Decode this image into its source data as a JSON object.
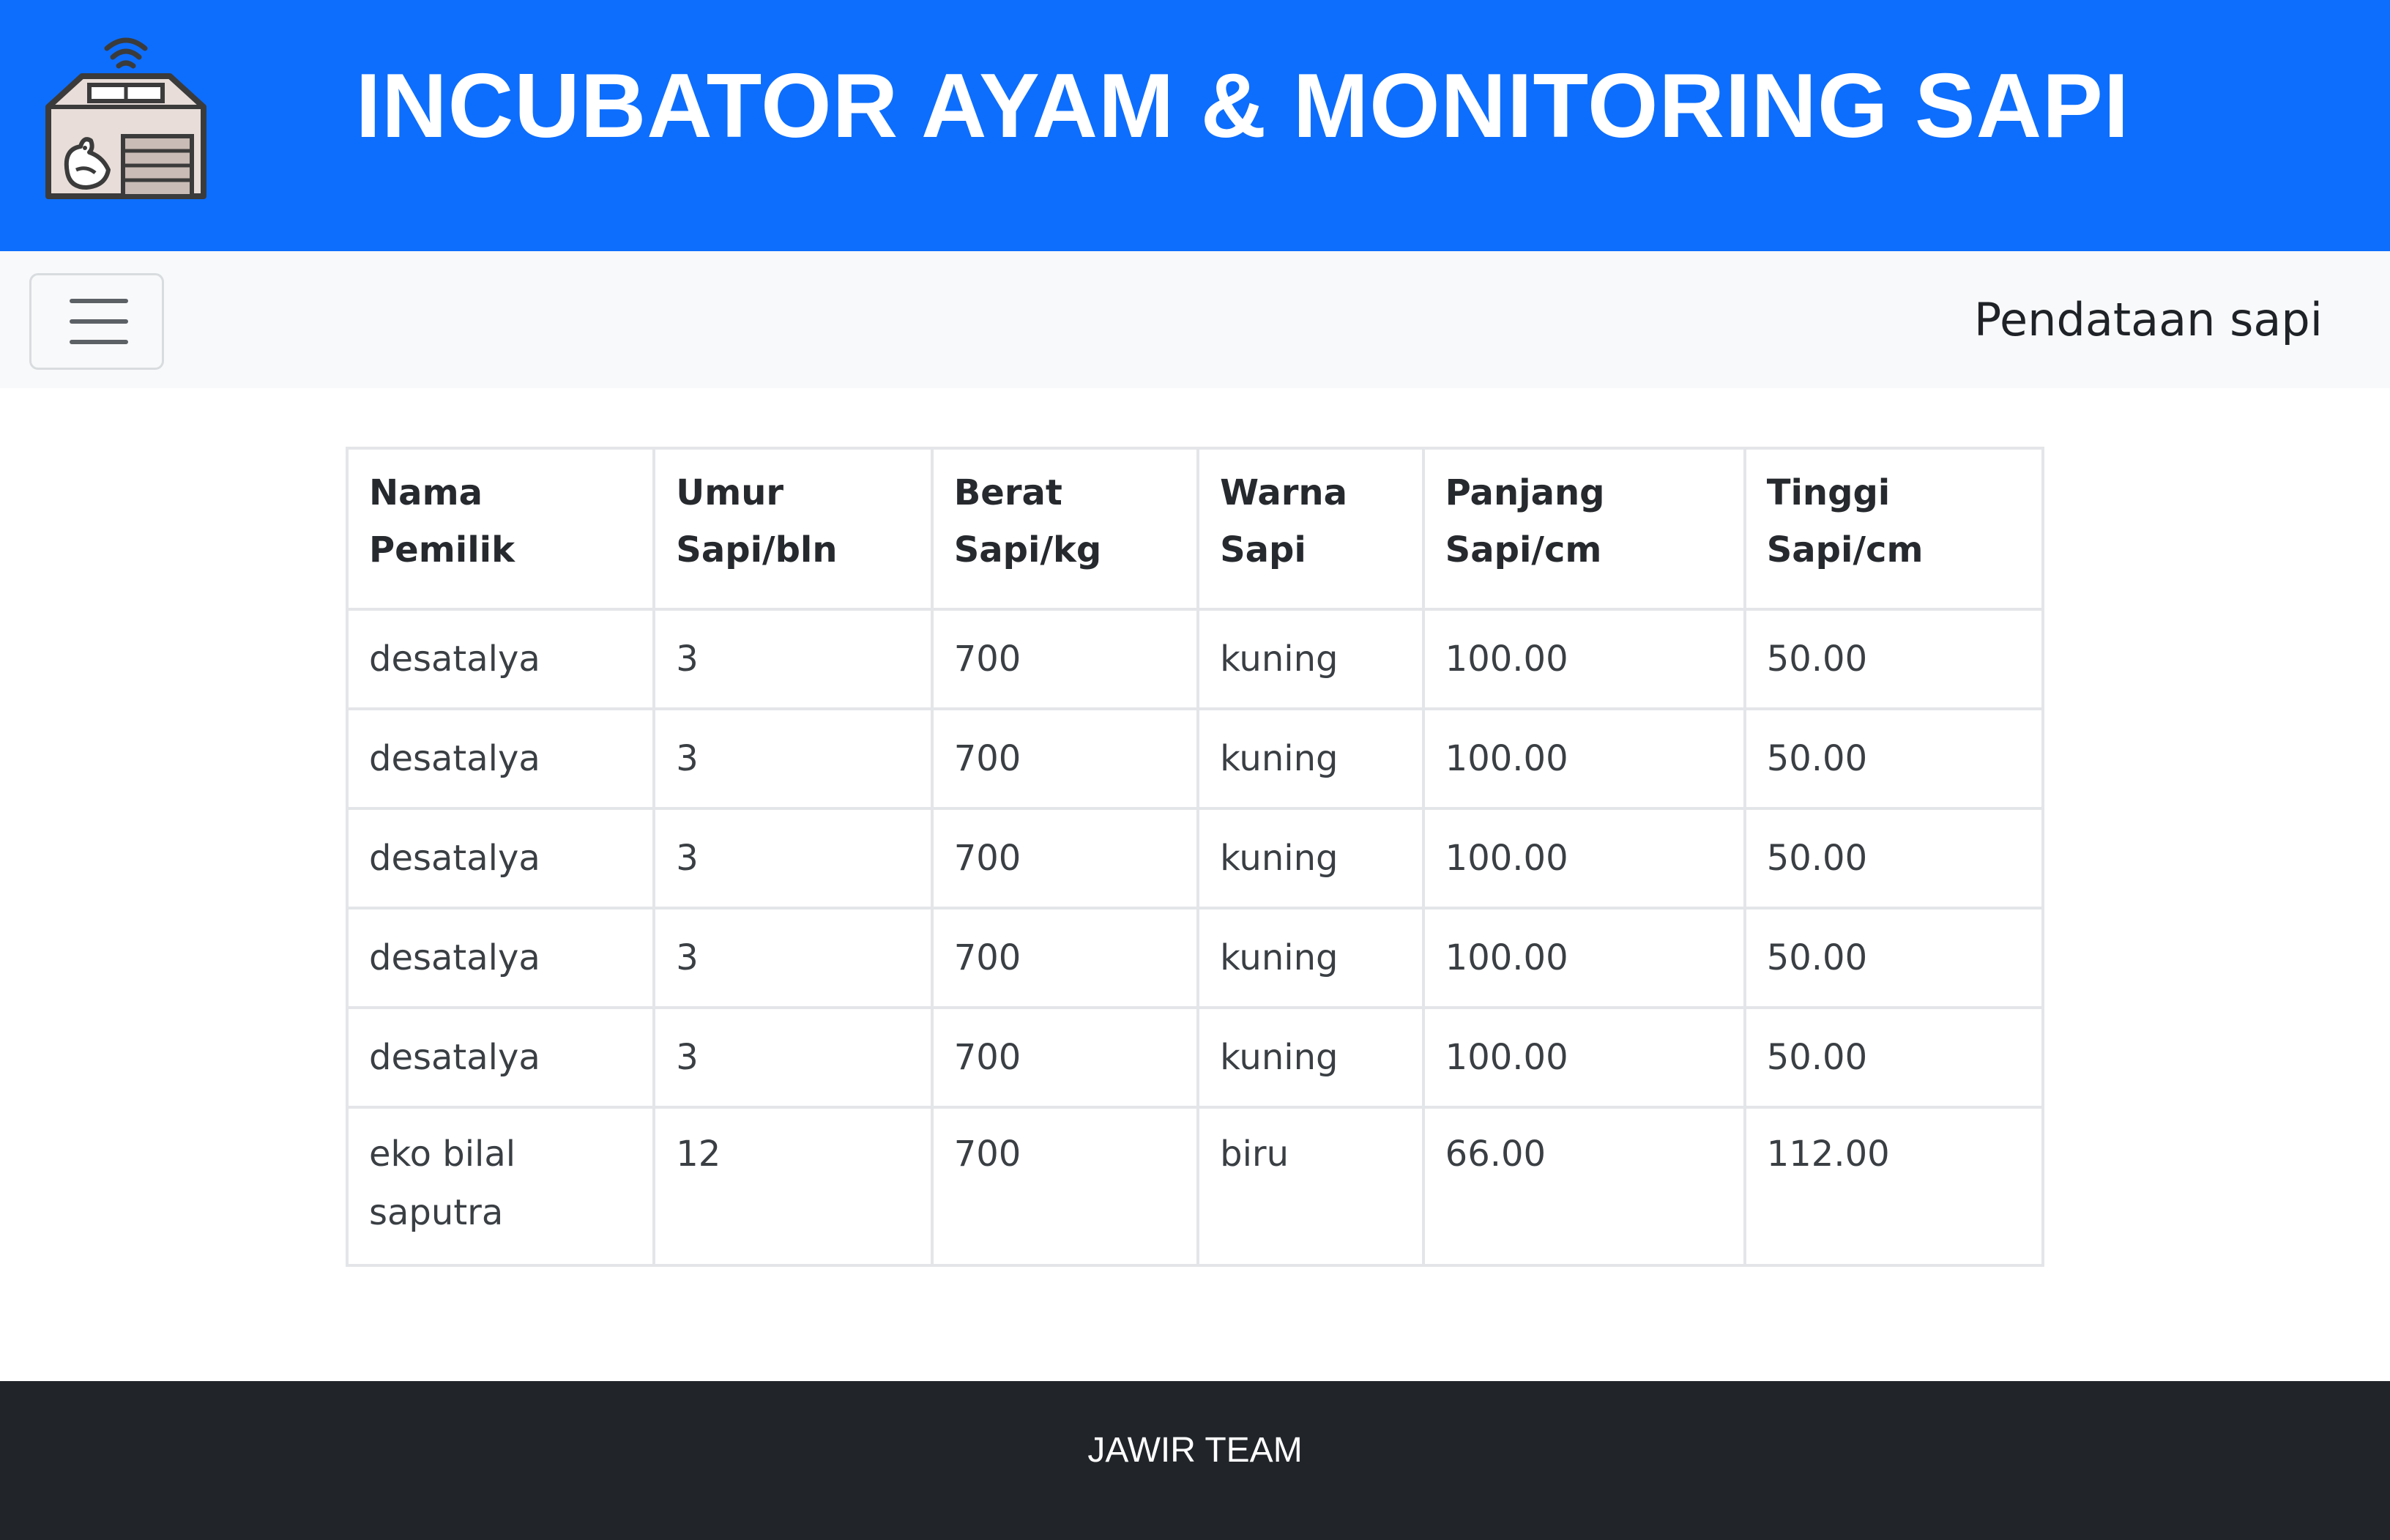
{
  "header": {
    "title": "INCUBATOR AYAM & MONITORING SAPI",
    "logo_icon": "barn-chicken-wifi-icon",
    "background_color": "#0d6efd"
  },
  "navbar": {
    "toggler_icon": "hamburger-menu-icon",
    "link_label": "Pendataan sapi"
  },
  "table": {
    "headers": {
      "owner": "Nama Pemilik",
      "age": "Umur Sapi/bln",
      "weight": "Berat Sapi/kg",
      "color": "Warna Sapi",
      "length": "Panjang Sapi/cm",
      "height": "Tinggi Sapi/cm"
    },
    "rows": [
      {
        "owner": "desatalya",
        "age": "3",
        "weight": "700",
        "color": "kuning",
        "length": "100.00",
        "height": "50.00"
      },
      {
        "owner": "desatalya",
        "age": "3",
        "weight": "700",
        "color": "kuning",
        "length": "100.00",
        "height": "50.00"
      },
      {
        "owner": "desatalya",
        "age": "3",
        "weight": "700",
        "color": "kuning",
        "length": "100.00",
        "height": "50.00"
      },
      {
        "owner": "desatalya",
        "age": "3",
        "weight": "700",
        "color": "kuning",
        "length": "100.00",
        "height": "50.00"
      },
      {
        "owner": "desatalya",
        "age": "3",
        "weight": "700",
        "color": "kuning",
        "length": "100.00",
        "height": "50.00"
      },
      {
        "owner": "eko bilal saputra",
        "age": "12",
        "weight": "700",
        "color": "biru",
        "length": "66.00",
        "height": "112.00"
      }
    ]
  },
  "footer": {
    "text": "JAWIR TEAM",
    "background_color": "#212529"
  }
}
